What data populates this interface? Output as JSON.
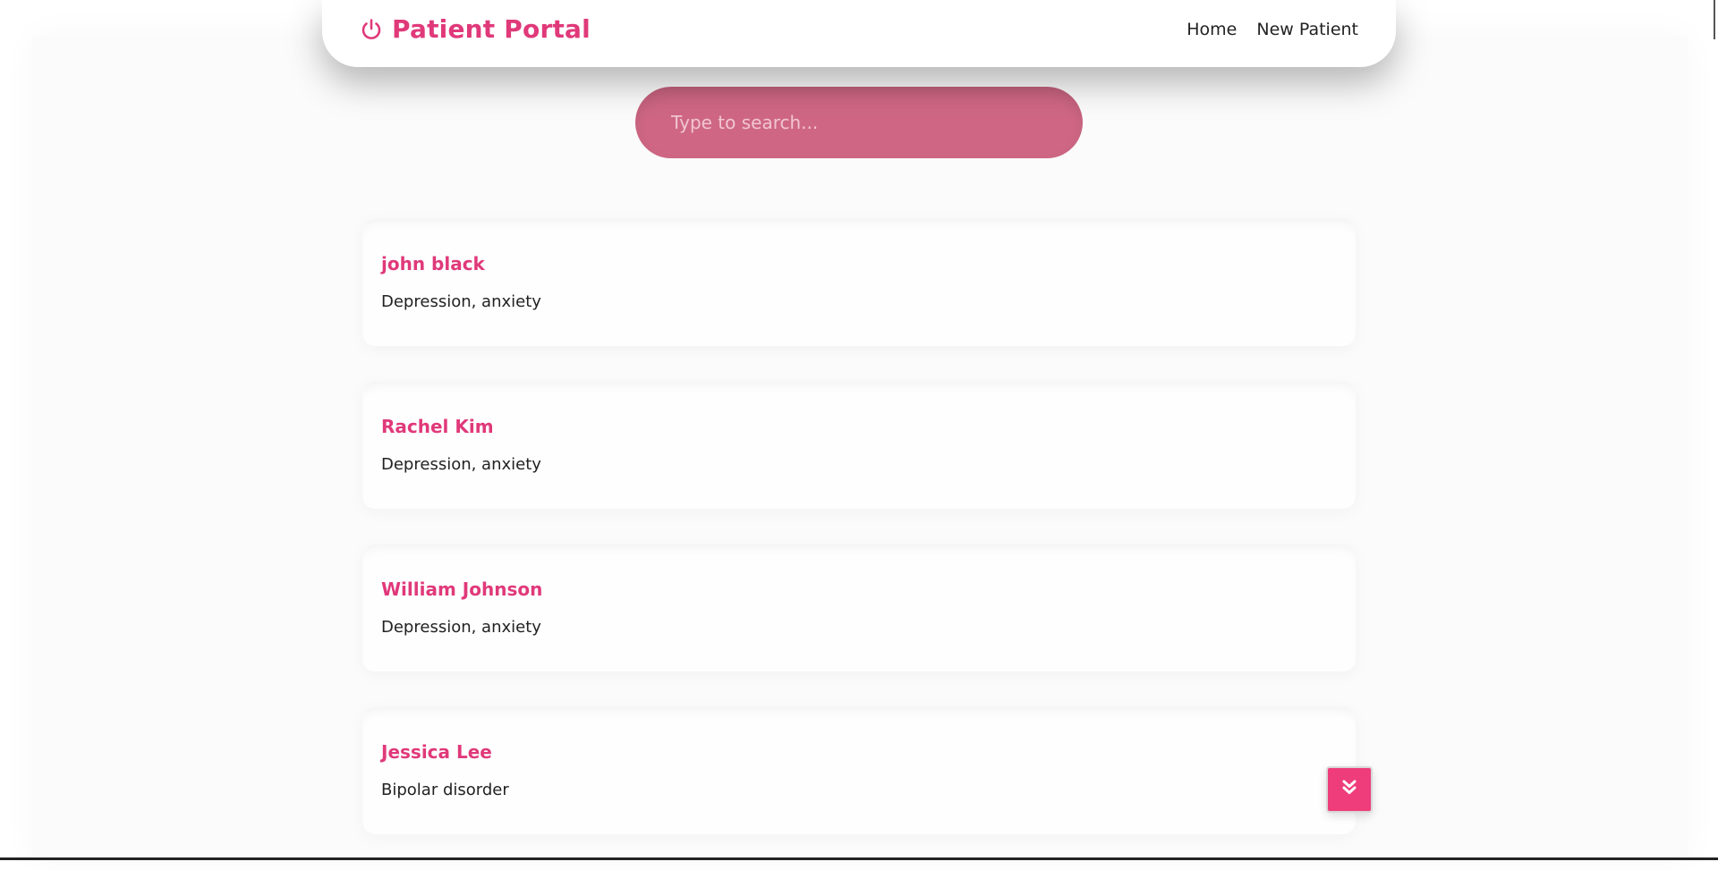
{
  "app": {
    "title": "Patient Portal"
  },
  "nav": {
    "links": [
      {
        "label": "Home"
      },
      {
        "label": "New Patient"
      }
    ]
  },
  "search": {
    "placeholder": "Type to search...",
    "value": ""
  },
  "patients": [
    {
      "name": "john black",
      "condition": "Depression, anxiety"
    },
    {
      "name": "Rachel Kim",
      "condition": "Depression, anxiety"
    },
    {
      "name": "William Johnson",
      "condition": "Depression, anxiety"
    },
    {
      "name": "Jessica Lee",
      "condition": "Bipolar disorder"
    }
  ],
  "icons": {
    "brand": "power-icon",
    "scroll": "chevron-double-down-icon"
  },
  "colors": {
    "accent": "#e0397a",
    "search_bg": "#cf6784",
    "button_bg": "#ee3d7a"
  }
}
